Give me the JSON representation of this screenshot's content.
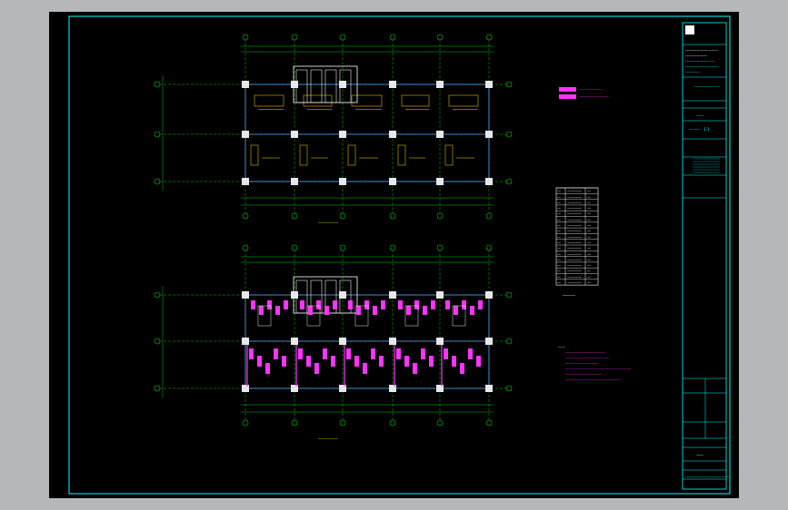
{
  "drawing": {
    "plan_upper_caption": "___________",
    "plan_lower_caption": "___________",
    "legend": [
      {
        "label": "——————",
        "color": "#ff33ff"
      },
      {
        "label": "————————",
        "color": "#ff33ff"
      }
    ],
    "schedule": {
      "caption": "_______",
      "rows": [
        [
          "—",
          "————",
          "—"
        ],
        [
          "—",
          "————",
          "—"
        ],
        [
          "—",
          "————",
          "—"
        ],
        [
          "—",
          "————",
          "—"
        ],
        [
          "—",
          "————",
          "—"
        ],
        [
          "—",
          "————",
          "—"
        ],
        [
          "—",
          "————",
          "—"
        ],
        [
          "—",
          "————",
          "—"
        ],
        [
          "—",
          "————",
          "—"
        ],
        [
          "—",
          "————",
          "—"
        ],
        [
          "—",
          "————",
          "—"
        ],
        [
          "—",
          "————",
          "—"
        ],
        [
          "—",
          "————",
          "—"
        ],
        [
          "—",
          "————",
          "—"
        ],
        [
          "—",
          "————",
          "—"
        ],
        [
          "—",
          "————",
          "—"
        ],
        [
          "—",
          "————",
          "—"
        ]
      ]
    },
    "notes": {
      "title": "——",
      "lines": [
        "———————————",
        "————————————",
        "—————————",
        "——————————————————",
        "——————————",
        "———————————————"
      ]
    }
  },
  "titleblock": {
    "company": [
      "—————————",
      "——————",
      "————————",
      "—————————",
      "————"
    ],
    "project": "———————",
    "drawing_name": "——",
    "drawing_no": "———",
    "scale_label": "1:1",
    "sign_rows": [
      "——",
      "——",
      "——",
      "——",
      "——",
      "——",
      "——",
      "——"
    ],
    "footer": "————————————"
  },
  "colors": {
    "frame": "#00ffff",
    "axis": "#00c800",
    "column": "#e8e8e8",
    "rebar": "#ff33ff",
    "text": "#ffe000",
    "beam": "#5aa0ff"
  }
}
